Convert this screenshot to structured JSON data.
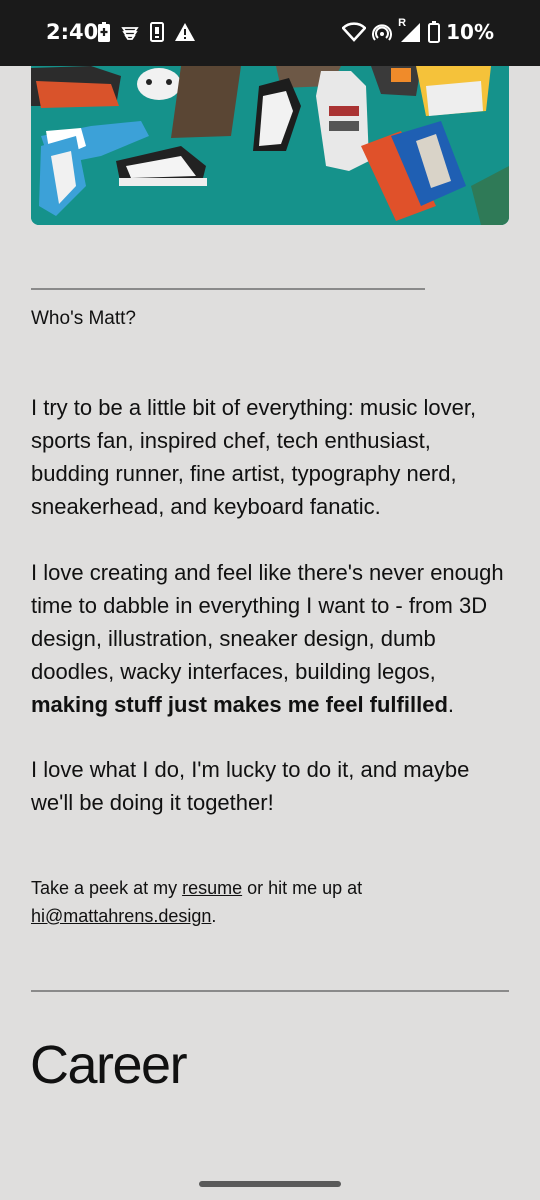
{
  "status_bar": {
    "time": "2:40",
    "battery_percent": "10%",
    "roaming_indicator": "R",
    "icons": [
      "battery-saver-icon",
      "sync-icon",
      "sim-icon",
      "warning-icon",
      "wifi-icon",
      "hotspot-icon",
      "signal-icon",
      "battery-icon"
    ]
  },
  "hero_image": {
    "description_icon": "sneakers-photo"
  },
  "about": {
    "section_label": "Who's Matt?",
    "paragraph1": "I try to be a little bit of everything: music lover, sports fan, inspired chef, tech enthusiast, budding runner, fine artist, typography nerd, sneakerhead, and keyboard fanatic.",
    "paragraph2_start": "I love creating and feel like there's never enough time to dabble in everything I want to - from 3D design, illustration, sneaker design, dumb doodles, wacky interfaces, building legos, ",
    "paragraph2_bold": "making stuff just makes me feel fulfilled",
    "paragraph2_end": ".",
    "paragraph3": "I love what I do, I'm lucky to do it, and maybe we'll be doing it together!"
  },
  "contact": {
    "text_before": "Take a peek at my ",
    "resume_link": "resume",
    "text_middle": " or hit me up at ",
    "email_link": "hi@mattahrens.design",
    "text_after": "."
  },
  "career": {
    "heading": "Career"
  }
}
